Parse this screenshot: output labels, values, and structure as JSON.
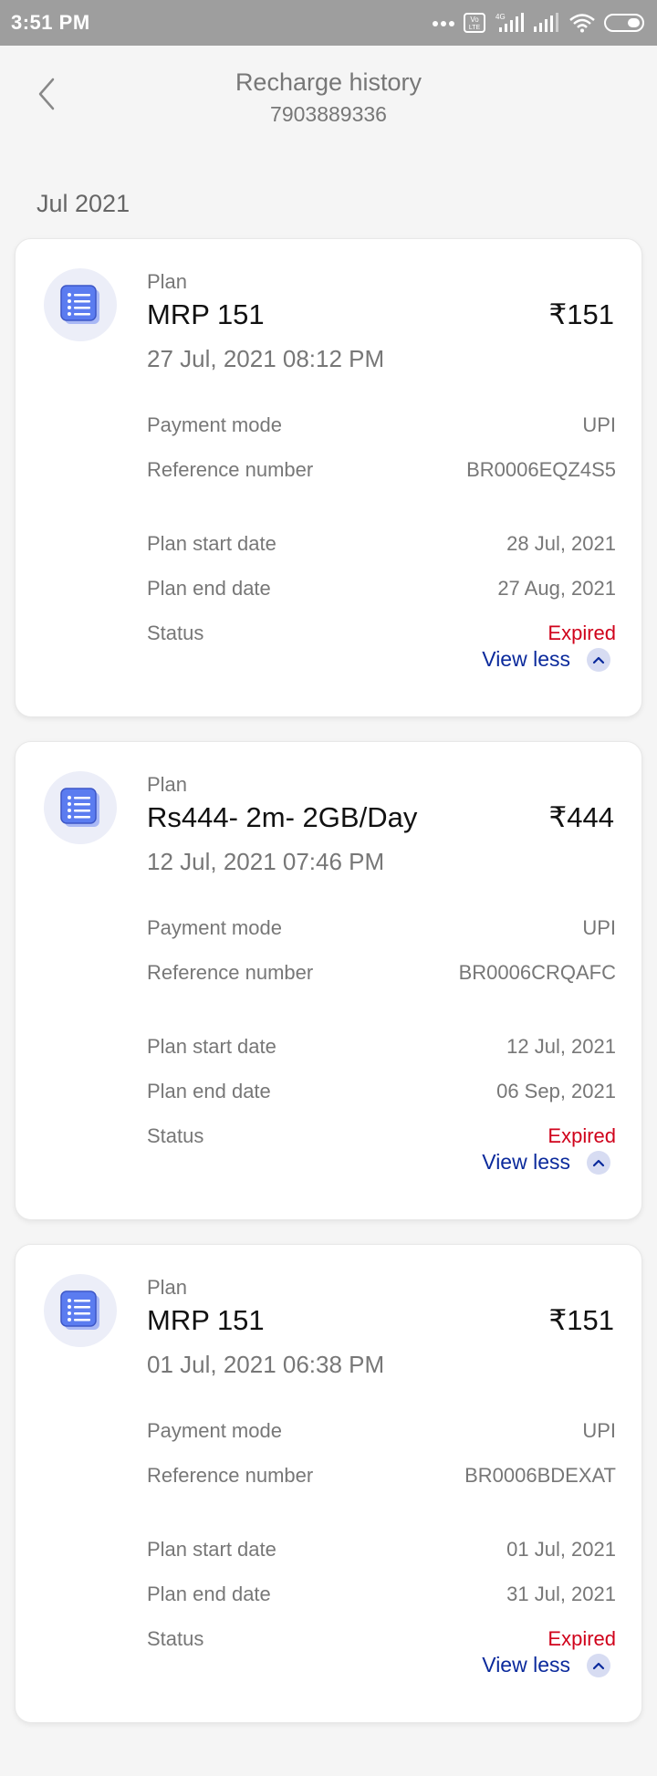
{
  "status_bar": {
    "time": "3:51 PM",
    "icons": [
      "more-dots-icon",
      "volte-icon",
      "signal-4g-icon",
      "signal-icon",
      "wifi-icon",
      "battery-icon"
    ],
    "volte_text": "Vo LTE",
    "network_text": "4G"
  },
  "header": {
    "title": "Recharge history",
    "subtitle": "7903889336"
  },
  "month": "Jul 2021",
  "colors": {
    "expired": "#d0021b",
    "link": "#0b2a9c",
    "icon_blue": "#5b7cf0"
  },
  "labels": {
    "plan_caption": "Plan",
    "payment_mode": "Payment mode",
    "reference_number": "Reference number",
    "plan_start_date": "Plan start date",
    "plan_end_date": "Plan end date",
    "status": "Status",
    "view_less": "View less"
  },
  "recharges": [
    {
      "name": "MRP 151",
      "price": "₹151",
      "datetime": "27 Jul, 2021 08:12 PM",
      "payment_mode": "UPI",
      "reference_number": "BR0006EQZ4S5",
      "start_date": "28 Jul, 2021",
      "end_date": "27 Aug, 2021",
      "status": "Expired"
    },
    {
      "name": "Rs444- 2m- 2GB/Day",
      "price": "₹444",
      "datetime": "12 Jul, 2021 07:46 PM",
      "payment_mode": "UPI",
      "reference_number": "BR0006CRQAFC",
      "start_date": "12 Jul, 2021",
      "end_date": "06 Sep, 2021",
      "status": "Expired"
    },
    {
      "name": "MRP 151",
      "price": "₹151",
      "datetime": "01 Jul, 2021 06:38 PM",
      "payment_mode": "UPI",
      "reference_number": "BR0006BDEXAT",
      "start_date": "01 Jul, 2021",
      "end_date": "31 Jul, 2021",
      "status": "Expired"
    }
  ]
}
